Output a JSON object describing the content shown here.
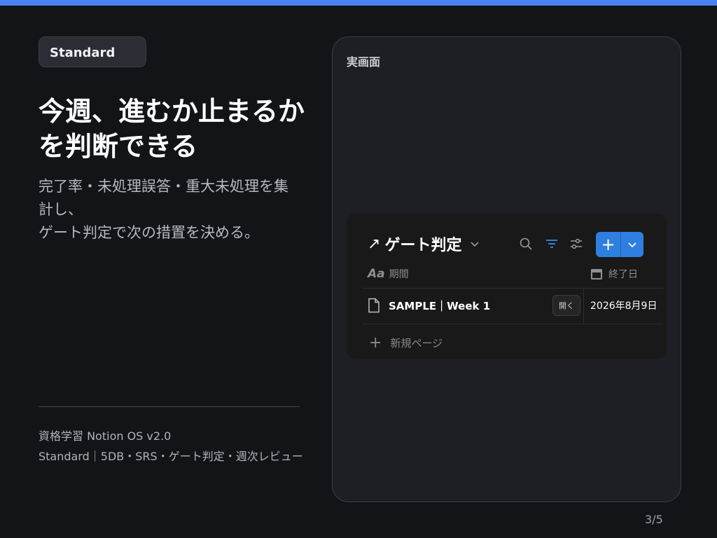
{
  "badge": "Standard",
  "headline": {
    "line1": "今週、進むか止まるか",
    "line2": "を判断できる"
  },
  "subtext": {
    "line1": "完了率・未処理誤答・重大未処理を集",
    "line2": "計し、",
    "line3": "ゲート判定で次の措置を決める。"
  },
  "footer": {
    "line1": "資格学習 Notion OS v2.0",
    "line2": "Standard｜5DB・SRS・ゲート判定・週次レビュー"
  },
  "page_number": "3/5",
  "screen_label": "実画面",
  "database": {
    "title": "ゲート判定",
    "title_icon": "arrow-up-right-icon",
    "columns": {
      "period": "期間",
      "end_date": "終了日"
    },
    "rows": [
      {
        "name": "SAMPLE｜Week 1",
        "open_label": "開く",
        "end_date": "2026年8月9日"
      }
    ],
    "new_page_label": "新規ページ",
    "new_button_symbol": "+"
  },
  "colors": {
    "accent_bar": "#4a83f0",
    "new_button": "#2f7fe0",
    "background": "#131418"
  }
}
